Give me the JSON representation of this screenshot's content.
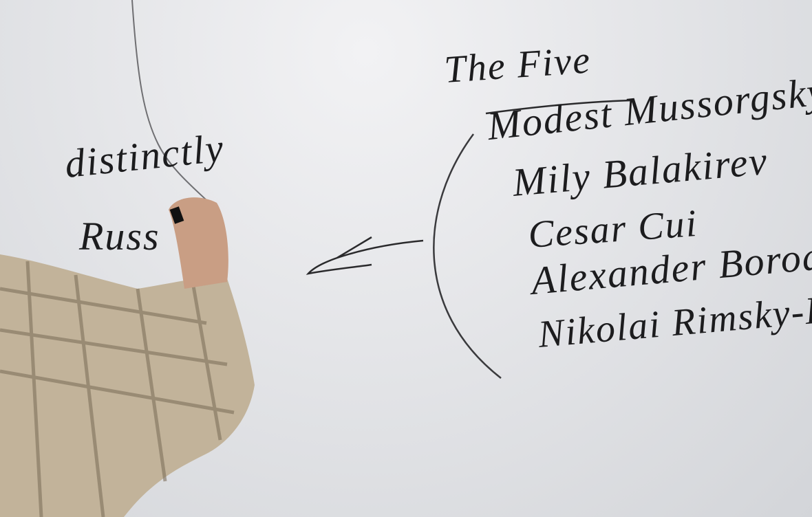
{
  "whiteboard": {
    "heading": "The Five",
    "composers": [
      "Modest Mussorgsky",
      "Mily Balakirev",
      "Cesar Cui",
      "Alexander Borodin",
      "Nikolai Rimsky-Ko"
    ],
    "left_text": {
      "line1": "distinctly",
      "line2": "Russ"
    }
  },
  "colors": {
    "marker": "#1c1c1e",
    "board": "#e4e5e8",
    "shirt": "#c2b39a"
  }
}
